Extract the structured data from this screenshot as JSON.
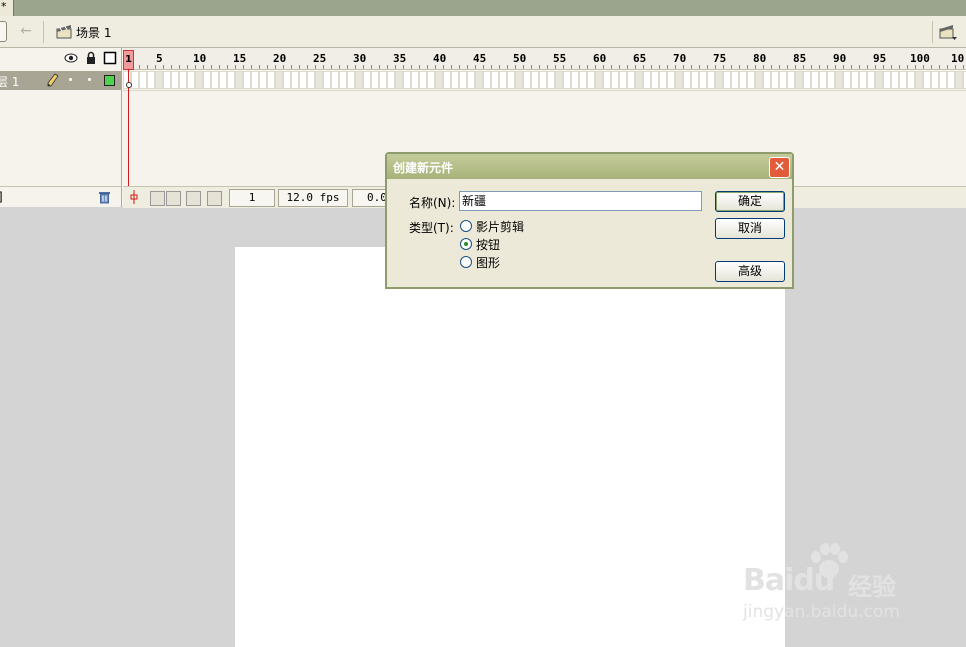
{
  "window": {
    "doc_tab_fragment": "*"
  },
  "edit_bar": {
    "scene_label": "场景 1"
  },
  "timeline": {
    "layer_name": "层 1",
    "footer_fragment": "]",
    "ruler_ticks": [
      "1",
      "5",
      "10",
      "15",
      "20",
      "25",
      "30",
      "35",
      "40",
      "45",
      "50",
      "55",
      "60",
      "65",
      "70",
      "75",
      "80",
      "85",
      "90",
      "95",
      "100",
      "10"
    ],
    "current_frame": "1",
    "frame_rate": "12.0 fps",
    "elapsed": "0.0"
  },
  "dialog": {
    "title": "创建新元件",
    "close_label": "✕",
    "name_label": "名称(N):",
    "name_value": "新疆",
    "type_label": "类型(T):",
    "types": [
      {
        "label": "影片剪辑",
        "checked": false
      },
      {
        "label": "按钮",
        "checked": true
      },
      {
        "label": "图形",
        "checked": false
      }
    ],
    "ok_label": "确定",
    "cancel_label": "取消",
    "advanced_label": "高级"
  },
  "watermark": {
    "brand_latin": "Bai",
    "brand_du": "du",
    "brand_cn": "经验",
    "url": "jingyan.baidu.com"
  },
  "colors": {
    "layer_color": "#4fd24f",
    "playhead": "#d21a1a",
    "dialog_title": "#a7b27a"
  }
}
